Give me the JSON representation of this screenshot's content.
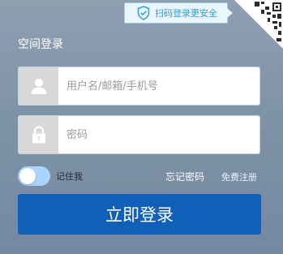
{
  "qr_tip": {
    "text": "扫码登录更安全",
    "icon": "shield-check-icon"
  },
  "qr_corner": {
    "icon": "qr-code-icon"
  },
  "form": {
    "title": "空间登录",
    "username": {
      "placeholder": "用户名/邮箱/手机号",
      "value": "",
      "icon": "user-icon"
    },
    "password": {
      "placeholder": "密码",
      "value": "",
      "icon": "lock-icon"
    },
    "remember_label": "记住我",
    "forgot_label": "忘记密码",
    "register_label": "免费注册",
    "submit_label": "立即登录"
  },
  "colors": {
    "background": "#8192a7",
    "accent": "#0f60b6",
    "tip_text": "#2a9fe6",
    "toggle": "#a9d5ff"
  }
}
